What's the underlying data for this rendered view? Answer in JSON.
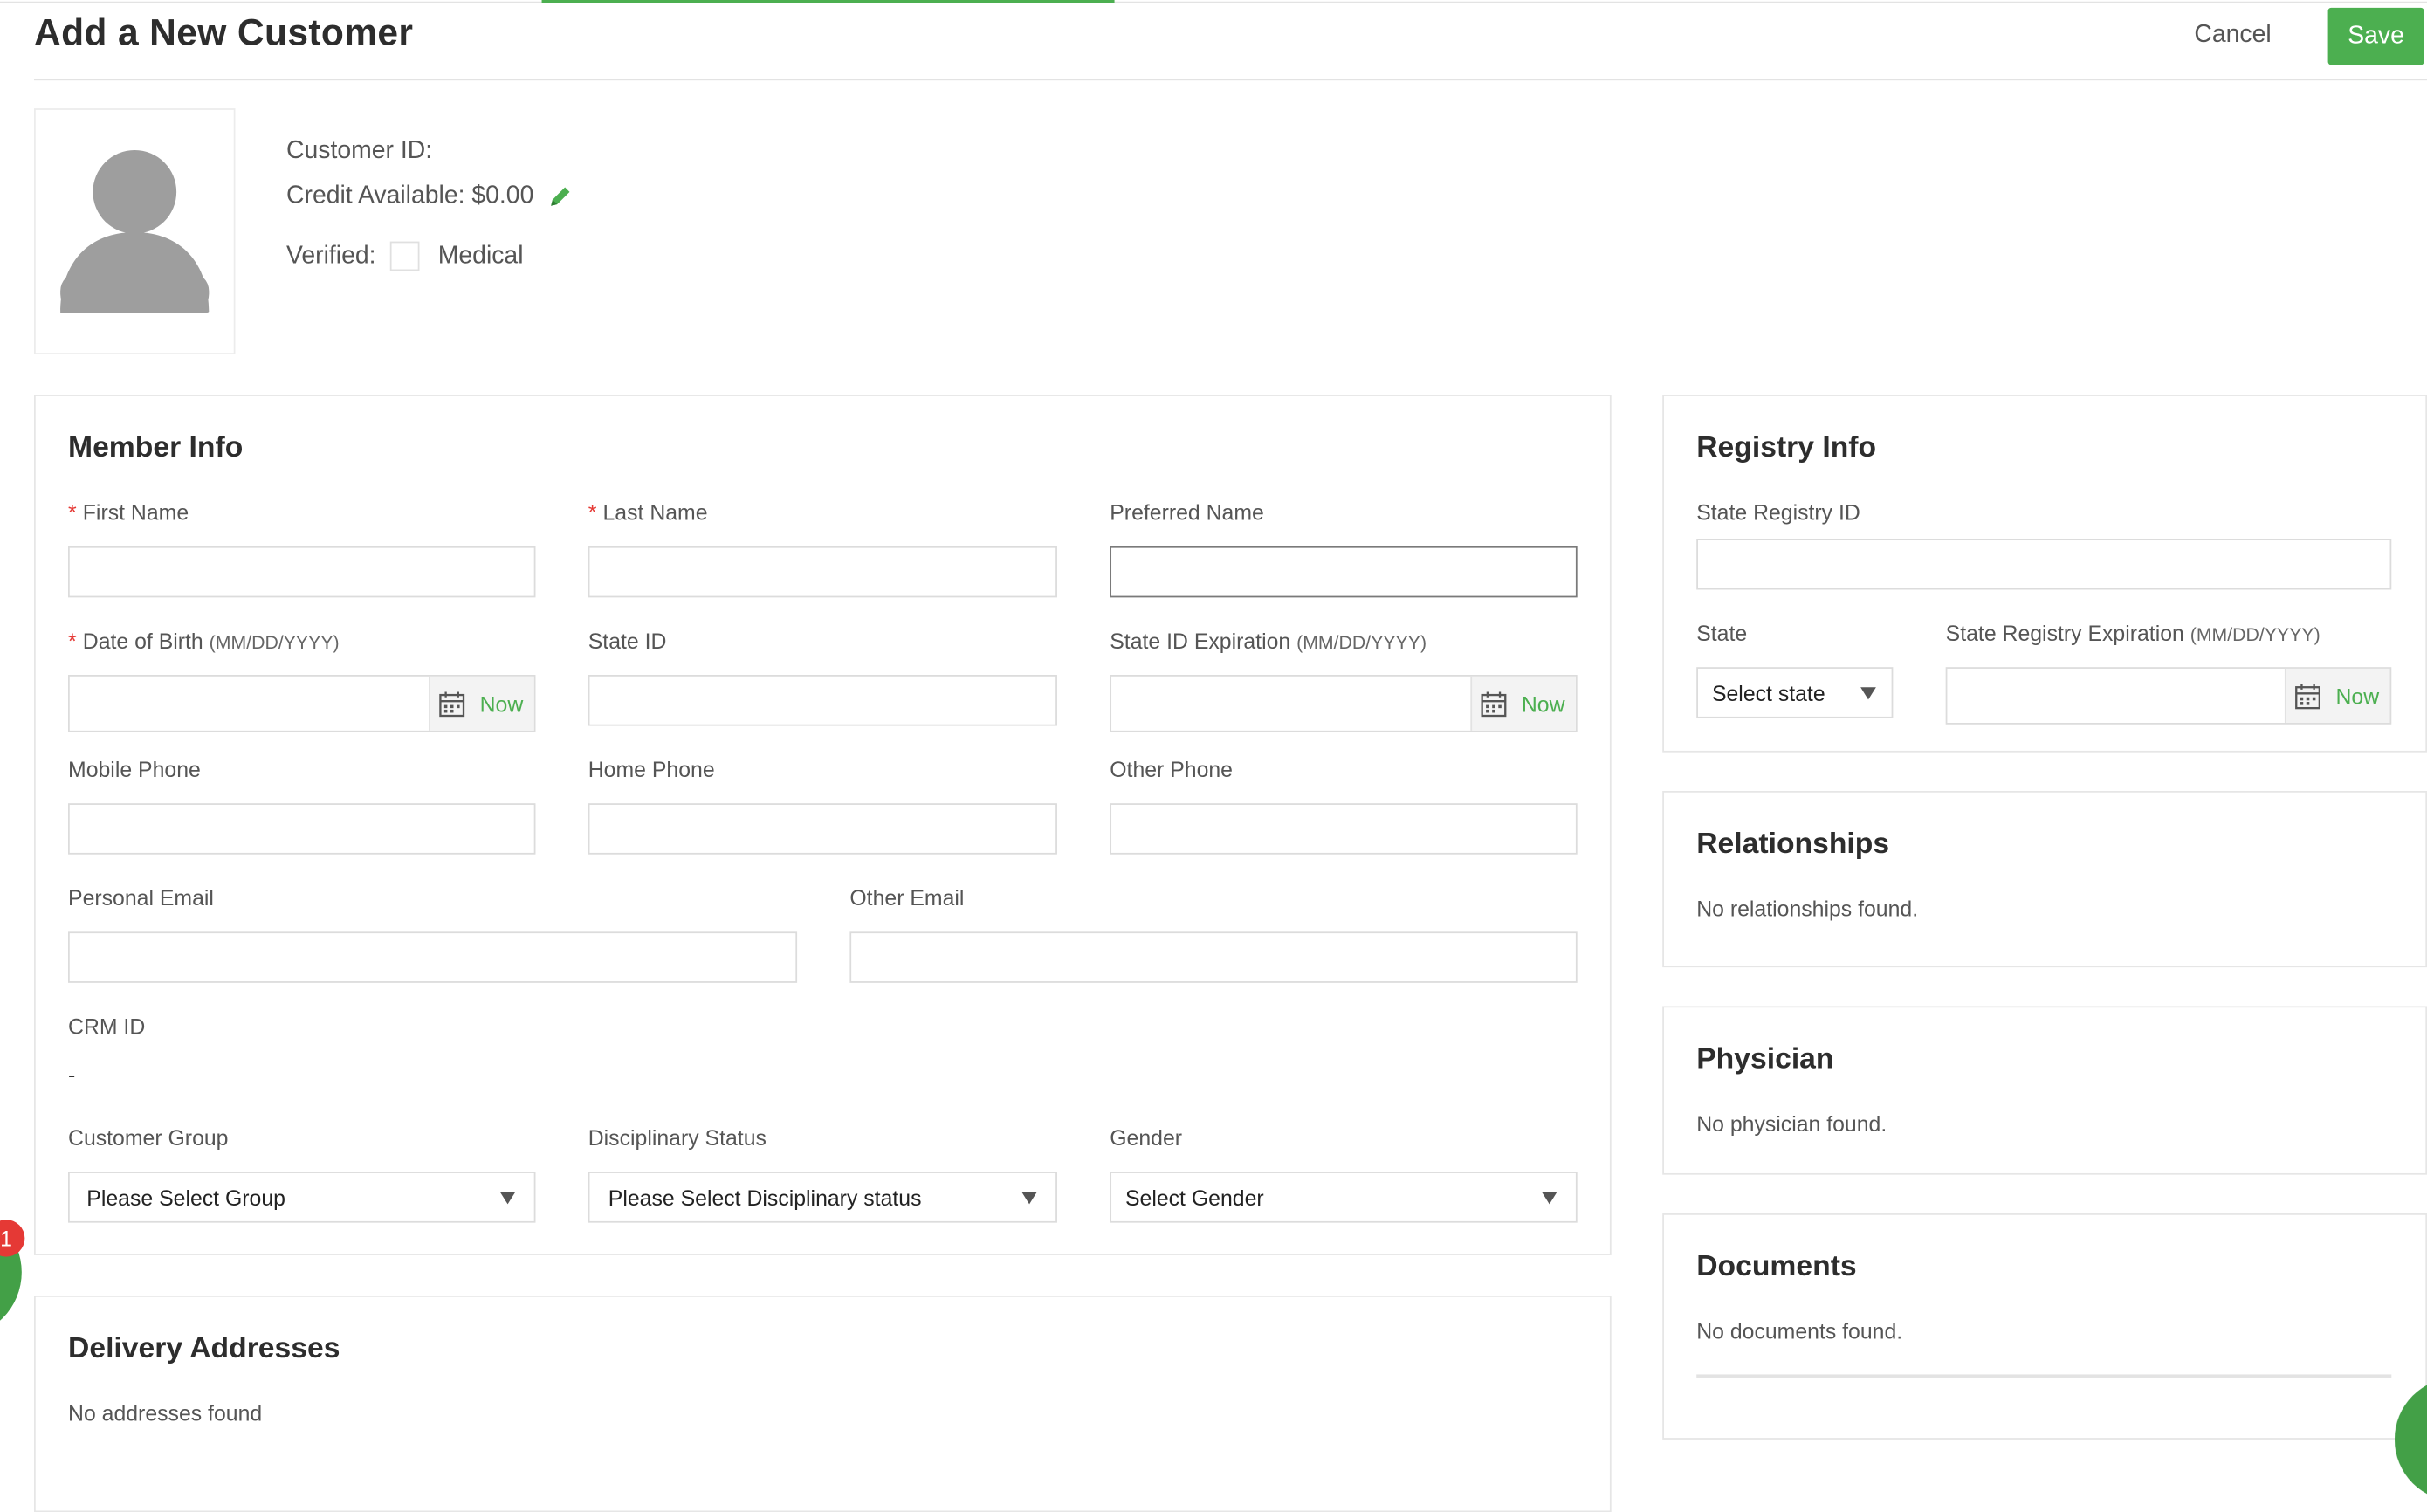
{
  "header": {
    "title": "Add a New Customer",
    "cancel_label": "Cancel",
    "save_label": "Save"
  },
  "profile": {
    "customer_id_label": "Customer ID:",
    "credit_label": "Credit Available: $0.00",
    "verified_label": "Verified:",
    "medical_label": "Medical"
  },
  "member_info": {
    "title": "Member Info",
    "first_name": "First Name",
    "last_name": "Last Name",
    "preferred_name": "Preferred Name",
    "dob": "Date of Birth",
    "dob_hint": "(MM/DD/YYYY)",
    "state_id": "State ID",
    "state_id_exp": "State ID Expiration",
    "state_id_exp_hint": "(MM/DD/YYYY)",
    "mobile_phone": "Mobile Phone",
    "home_phone": "Home Phone",
    "other_phone": "Other Phone",
    "personal_email": "Personal Email",
    "other_email": "Other Email",
    "crm_id": "CRM ID",
    "crm_id_value": "-",
    "customer_group": "Customer Group",
    "customer_group_value": "Please Select Group",
    "disciplinary_status": "Disciplinary Status",
    "disciplinary_status_value": "Please Select Disciplinary status",
    "gender": "Gender",
    "gender_value": "Select Gender",
    "now_label": "Now",
    "required_mark": "*"
  },
  "delivery": {
    "title": "Delivery Addresses",
    "empty": "No addresses found"
  },
  "registry": {
    "title": "Registry Info",
    "state_registry_id": "State Registry ID",
    "state": "State",
    "state_value": "Select state",
    "state_registry_exp": "State Registry Expiration",
    "state_registry_exp_hint": "(MM/DD/YYYY)",
    "now_label": "Now"
  },
  "relationships": {
    "title": "Relationships",
    "empty": "No relationships found."
  },
  "physician": {
    "title": "Physician",
    "empty": "No physician found."
  },
  "documents": {
    "title": "Documents",
    "empty": "No documents found."
  },
  "chat": {
    "badge_count": "1"
  },
  "colors": {
    "accent": "#4caf50",
    "required": "#e53935"
  }
}
